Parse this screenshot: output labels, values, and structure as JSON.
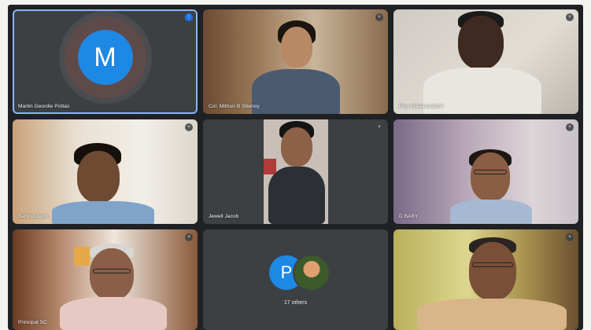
{
  "meeting": {
    "participants": [
      {
        "name": "Martin Geordie Pottas",
        "avatar_letter": "M",
        "speaking": true
      },
      {
        "name": "Col. Mithun B Shenoy"
      },
      {
        "name": "Pius Malekandathil"
      },
      {
        "name": "Sahil Joseph"
      },
      {
        "name": "Jewell Jacob"
      },
      {
        "name": "D BABY"
      },
      {
        "name": "Principal SC"
      },
      {
        "name": ""
      }
    ],
    "others": {
      "avatar_letter": "P",
      "label": "17 others"
    }
  },
  "colors": {
    "tile_bg": "#3c4043",
    "accent": "#1a73e8",
    "avatar_blue": "#1e88e5"
  },
  "icons": {
    "muted": "mic-off-icon",
    "speaking": "audio-level-icon"
  }
}
